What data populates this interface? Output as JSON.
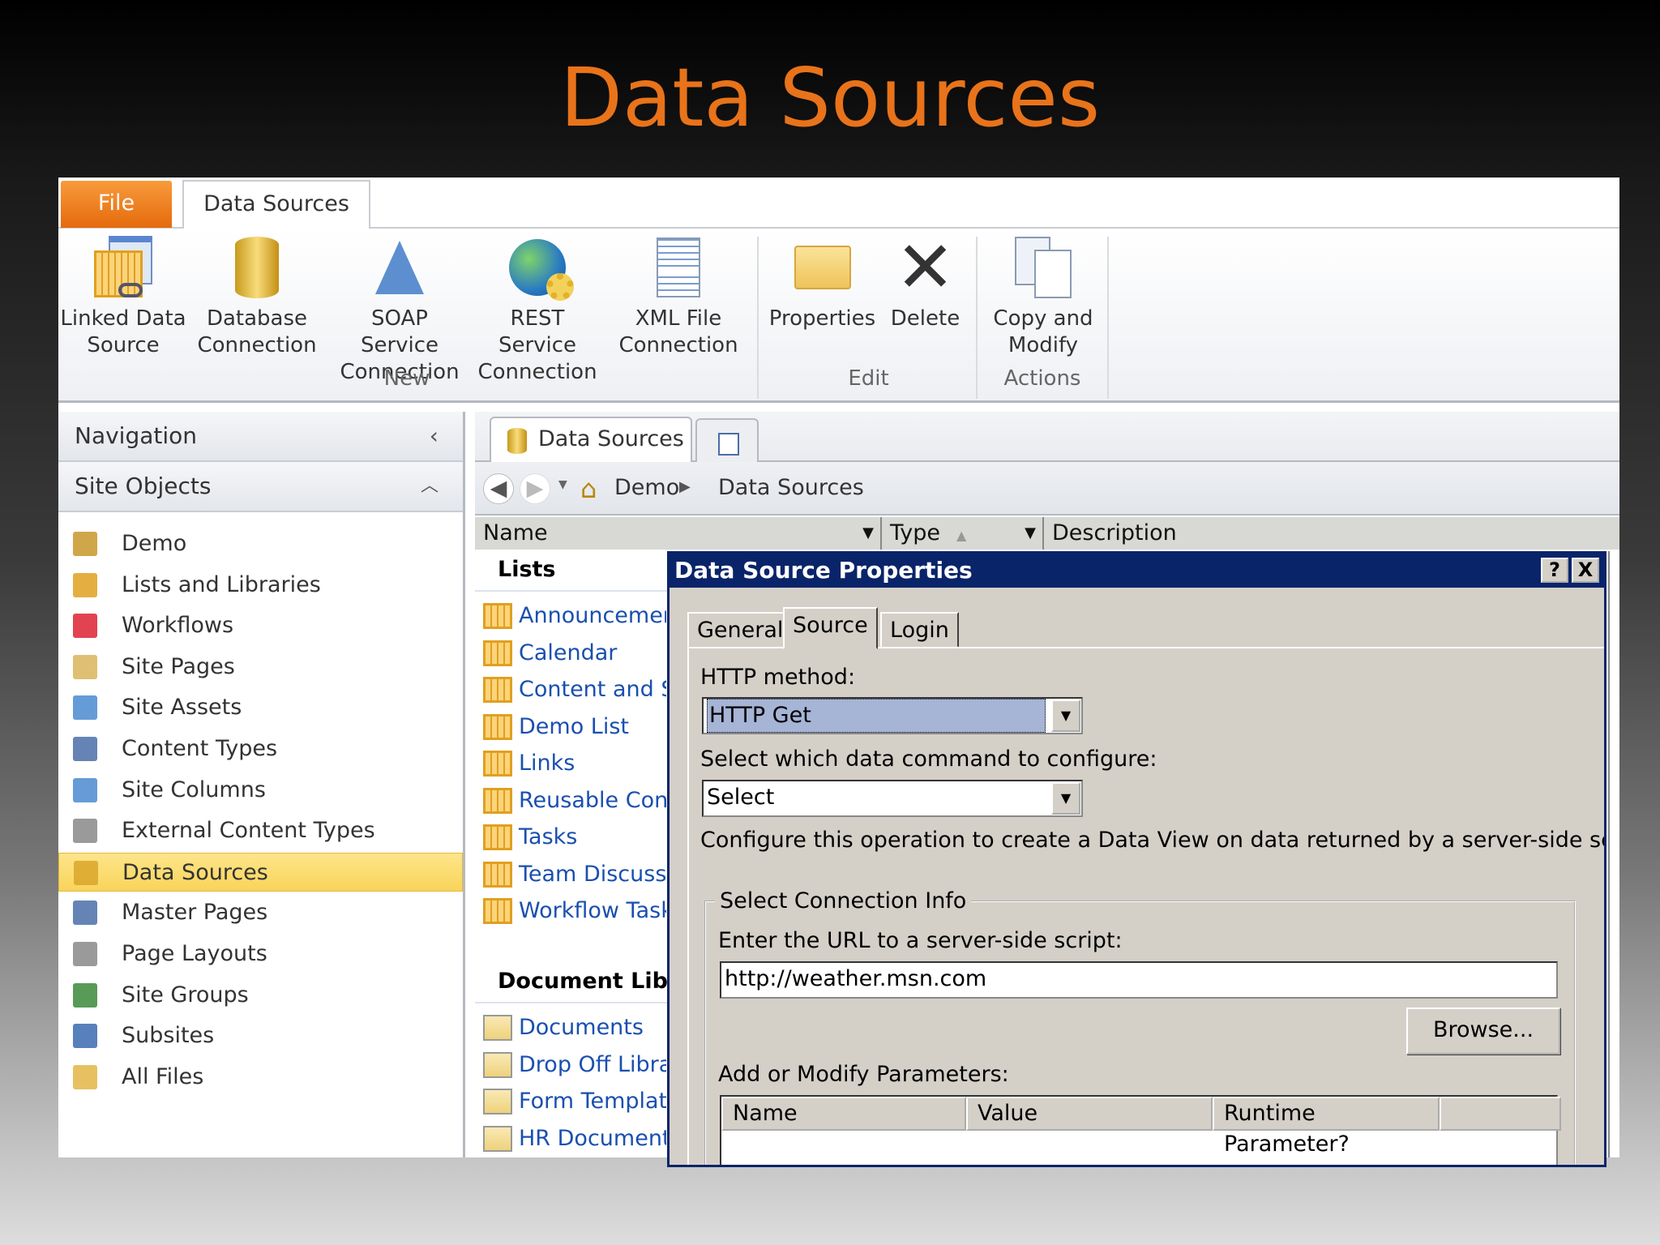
{
  "slide_title": "Data Sources",
  "ribbon": {
    "file_tab": "File",
    "active_tab": "Data Sources",
    "groups": [
      {
        "label": "New",
        "buttons": [
          {
            "line1": "Linked Data",
            "line2": "Source"
          },
          {
            "line1": "Database",
            "line2": "Connection"
          },
          {
            "line1": "SOAP Service",
            "line2": "Connection"
          },
          {
            "line1": "REST Service",
            "line2": "Connection"
          },
          {
            "line1": "XML File",
            "line2": "Connection"
          }
        ]
      },
      {
        "label": "Edit",
        "buttons": [
          {
            "line1": "Properties",
            "line2": ""
          },
          {
            "line1": "Delete",
            "line2": ""
          }
        ]
      },
      {
        "label": "Actions",
        "buttons": [
          {
            "line1": "Copy and",
            "line2": "Modify"
          }
        ]
      }
    ]
  },
  "nav": {
    "header": "Navigation",
    "section": "Site Objects",
    "items": [
      "Demo",
      "Lists and Libraries",
      "Workflows",
      "Site Pages",
      "Site Assets",
      "Content Types",
      "Site Columns",
      "External Content Types",
      "Data Sources",
      "Master Pages",
      "Page Layouts",
      "Site Groups",
      "Subsites",
      "All Files"
    ],
    "selected": "Data Sources"
  },
  "main": {
    "tab": "Data Sources",
    "breadcrumb": [
      "Demo",
      "Data Sources"
    ],
    "columns": [
      "Name",
      "Type",
      "Description"
    ],
    "lists_heading": "Lists",
    "lists": [
      "Announcement",
      "Calendar",
      "Content and St",
      "Demo List",
      "Links",
      "Reusable Cont",
      "Tasks",
      "Team Discussic",
      "Workflow Task"
    ],
    "doclib_heading": "Document Libr",
    "doclibs": [
      "Documents",
      "Drop Off Librar",
      "Form Template",
      "HR Documents"
    ]
  },
  "dialog": {
    "title": "Data Source Properties",
    "help": "?",
    "close": "X",
    "tabs": [
      "General",
      "Source",
      "Login"
    ],
    "active_tab": "Source",
    "http_method_label": "HTTP method:",
    "http_method_value": "HTTP Get",
    "command_label": "Select which data command to configure:",
    "command_value": "Select",
    "configure_text": "Configure this operation to create a Data View on data returned by a server-side script.",
    "group_label": "Select Connection Info",
    "url_label": "Enter the URL to a server-side script:",
    "url_value": "http://weather.msn.com",
    "browse": "Browse...",
    "params_label": "Add or Modify Parameters:",
    "params_columns": [
      "Name",
      "Value",
      "Runtime Parameter?"
    ]
  }
}
